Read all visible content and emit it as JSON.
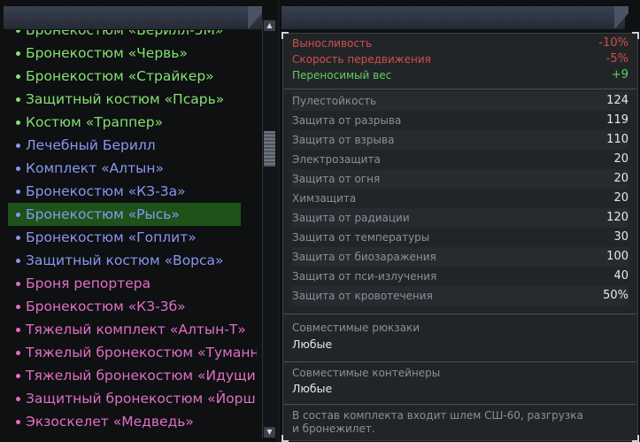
{
  "colors": {
    "green": "#86e071",
    "blue": "#8a96f0",
    "pink": "#e06fc4",
    "red_stat": "#d24d4d",
    "green_stat": "#5fcf5f",
    "selected_bg": "#1d5318"
  },
  "items": [
    {
      "label": "Бронекостюм «Берилл-5М»",
      "color": "#86e071"
    },
    {
      "label": "Бронекостюм «Червь»",
      "color": "#86e071"
    },
    {
      "label": "Бронекостюм «Страйкер»",
      "color": "#86e071"
    },
    {
      "label": "Защитный костюм «Псарь»",
      "color": "#86e071"
    },
    {
      "label": "Костюм «Траппер»",
      "color": "#86e071"
    },
    {
      "label": "Лечебный Берилл",
      "color": "#8a96f0"
    },
    {
      "label": "Комплект «Алтын»",
      "color": "#8a96f0"
    },
    {
      "label": "Бронекостюм «КЗ-3а»",
      "color": "#8a96f0"
    },
    {
      "label": "Бронекостюм «Рысь»",
      "color": "#8a96f0",
      "selected": true
    },
    {
      "label": "Бронекостюм «Гоплит»",
      "color": "#8a96f0"
    },
    {
      "label": "Защитный костюм «Ворса»",
      "color": "#8a96f0"
    },
    {
      "label": "Броня репортера",
      "color": "#e06fc4"
    },
    {
      "label": "Бронекостюм «КЗ-3б»",
      "color": "#e06fc4"
    },
    {
      "label": "Тяжелый комплект «Алтын-Т»",
      "color": "#e06fc4"
    },
    {
      "label": "Тяжелый бронекостюм «Туманность»",
      "color": "#e06fc4"
    },
    {
      "label": "Тяжелый бронекостюм «Идущий»",
      "color": "#e06fc4"
    },
    {
      "label": "Защитный бронекостюм «Йорш»",
      "color": "#e06fc4"
    },
    {
      "label": "Экзоскелет «Медведь»",
      "color": "#e06fc4"
    }
  ],
  "modifiers": [
    {
      "label": "Выносливость",
      "value": "-10%",
      "color": "#d24d4d"
    },
    {
      "label": "Скорость передвижения",
      "value": "-5%",
      "color": "#d24d4d"
    },
    {
      "label": "Переносимый вес",
      "value": "+9",
      "color": "#5fcf5f"
    }
  ],
  "stats": [
    {
      "label": "Пулестойкость",
      "value": "124"
    },
    {
      "label": "Защита от разрыва",
      "value": "119"
    },
    {
      "label": "Защита от взрыва",
      "value": "110"
    },
    {
      "label": "Электрозащита",
      "value": "20"
    },
    {
      "label": "Защита от огня",
      "value": "20"
    },
    {
      "label": "Химзащита",
      "value": "20"
    },
    {
      "label": "Защита от радиации",
      "value": "120"
    },
    {
      "label": "Защита от температуры",
      "value": "30"
    },
    {
      "label": "Защита от биозаражения",
      "value": "100"
    },
    {
      "label": "Защита от пси-излучения",
      "value": "40"
    },
    {
      "label": "Защита от кровотечения",
      "value": "50%"
    }
  ],
  "backpacks": {
    "label": "Совместимые рюкзаки",
    "value": "Любые"
  },
  "containers": {
    "label": "Совместимые контейнеры",
    "value": "Любые"
  },
  "description": "В состав комплекта входит шлем СШ-60, разгрузка и бронежилет."
}
